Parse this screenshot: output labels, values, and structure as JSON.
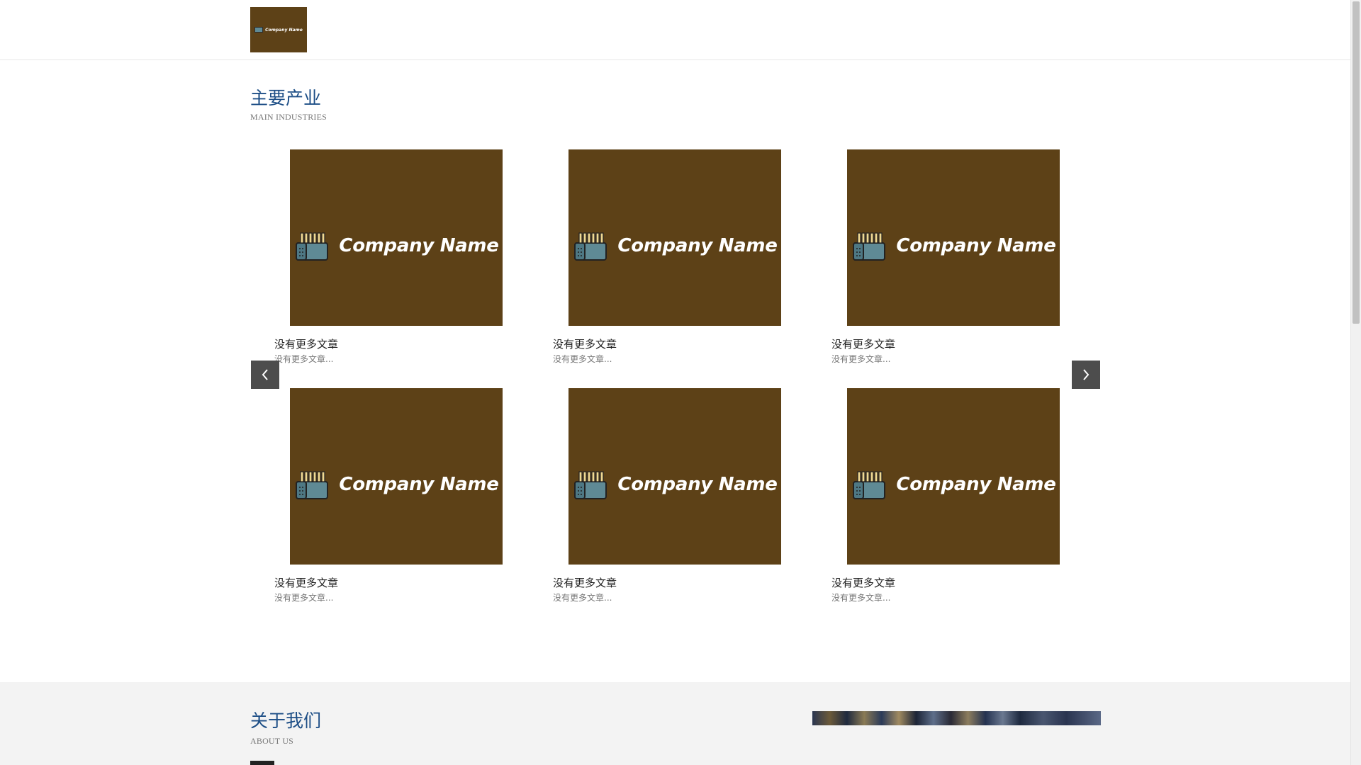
{
  "header": {
    "logo_text": "Company Name"
  },
  "main_industries": {
    "title": "主要产业",
    "subtitle": "MAIN INDUSTRIES",
    "cards": [
      {
        "image_text": "Company Name",
        "title": "没有更多文章",
        "excerpt": "没有更多文章..."
      },
      {
        "image_text": "Company Name",
        "title": "没有更多文章",
        "excerpt": "没有更多文章..."
      },
      {
        "image_text": "Company Name",
        "title": "没有更多文章",
        "excerpt": "没有更多文章..."
      },
      {
        "image_text": "Company Name",
        "title": "没有更多文章",
        "excerpt": "没有更多文章..."
      },
      {
        "image_text": "Company Name",
        "title": "没有更多文章",
        "excerpt": "没有更多文章..."
      },
      {
        "image_text": "Company Name",
        "title": "没有更多文章",
        "excerpt": "没有更多文章..."
      }
    ],
    "prev_icon": "chevron-left-icon",
    "next_icon": "chevron-right-icon"
  },
  "about": {
    "title": "关于我们",
    "subtitle": "ABOUT US"
  },
  "colors": {
    "brand_brown": "#5d4117",
    "title_blue": "#1d4e86",
    "arrow_bg": "#4d4d4d",
    "about_bg": "#f3f3f3"
  },
  "icons": {
    "logo_mark": "battery-pack-icon"
  }
}
